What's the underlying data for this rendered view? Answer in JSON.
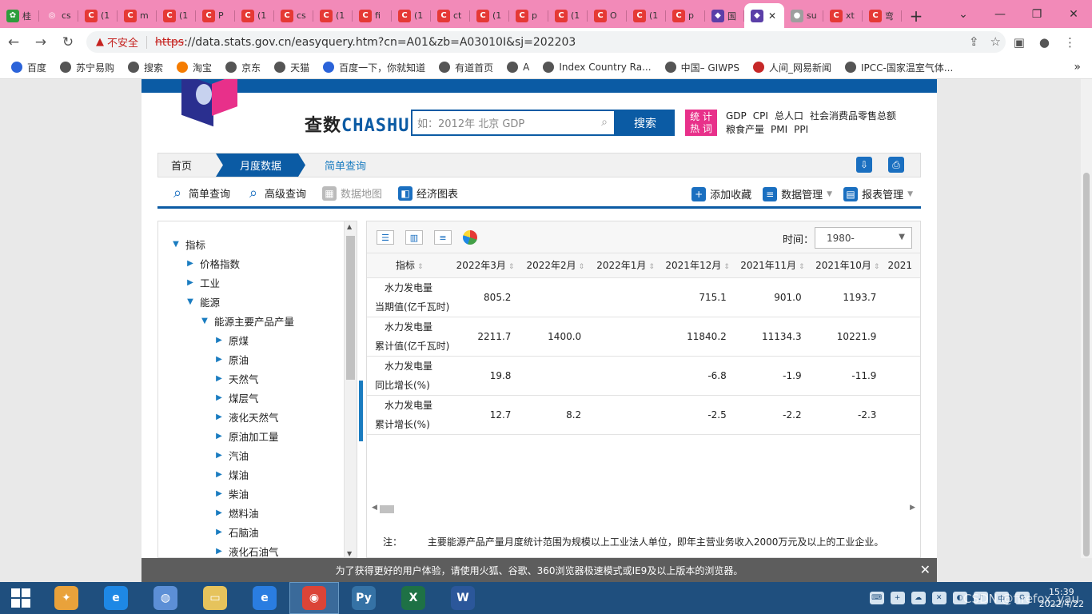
{
  "tabs": [
    {
      "label": "桂",
      "color": "#2e9d3c",
      "glyph": "✿"
    },
    {
      "label": "cs",
      "color": "#f28ab8",
      "glyph": "◎"
    },
    {
      "label": "(1",
      "color": "#e53935",
      "glyph": "C"
    },
    {
      "label": "m",
      "color": "#e53935",
      "glyph": "C"
    },
    {
      "label": "(1",
      "color": "#e53935",
      "glyph": "C"
    },
    {
      "label": "P",
      "color": "#e53935",
      "glyph": "C"
    },
    {
      "label": "(1",
      "color": "#e53935",
      "glyph": "C"
    },
    {
      "label": "cs",
      "color": "#e53935",
      "glyph": "C"
    },
    {
      "label": "(1",
      "color": "#e53935",
      "glyph": "C"
    },
    {
      "label": "fi",
      "color": "#e53935",
      "glyph": "C"
    },
    {
      "label": "(1",
      "color": "#e53935",
      "glyph": "C"
    },
    {
      "label": "ct",
      "color": "#e53935",
      "glyph": "C"
    },
    {
      "label": "(1",
      "color": "#e53935",
      "glyph": "C"
    },
    {
      "label": "p",
      "color": "#e53935",
      "glyph": "C"
    },
    {
      "label": "(1",
      "color": "#e53935",
      "glyph": "C"
    },
    {
      "label": "O",
      "color": "#e53935",
      "glyph": "C"
    },
    {
      "label": "(1",
      "color": "#e53935",
      "glyph": "C"
    },
    {
      "label": "p",
      "color": "#e53935",
      "glyph": "C"
    },
    {
      "label": "国",
      "color": "#5b3fa8",
      "glyph": "◆"
    }
  ],
  "active_tab": {
    "label": "",
    "close": "✕"
  },
  "tabs_after": [
    {
      "label": "su",
      "color": "#9e9e9e",
      "glyph": "●"
    },
    {
      "label": "xt",
      "color": "#e53935",
      "glyph": "C"
    },
    {
      "label": "弯",
      "color": "#e53935",
      "glyph": "C"
    }
  ],
  "new_tab_label": "+",
  "window_controls": [
    "⌄",
    "—",
    "❐",
    "✕"
  ],
  "nav": {
    "back": "←",
    "forward": "→",
    "reload": "↻"
  },
  "address": {
    "warning_icon": "▲",
    "insecure_label": "不安全",
    "url_scheme": "https",
    "url_rest": "://data.stats.gov.cn/easyquery.htm?cn=A01&zb=A03010I&sj=202203"
  },
  "omnibox_icons": [
    "⇪",
    "☆"
  ],
  "toolbar_icons": [
    "▣",
    "●",
    "⋮"
  ],
  "bookmarks": [
    {
      "label": "百度",
      "color": "#2b63d9"
    },
    {
      "label": "苏宁易购",
      "color": "#555"
    },
    {
      "label": "搜索",
      "color": "#555"
    },
    {
      "label": "淘宝",
      "color": "#f57c00"
    },
    {
      "label": "京东",
      "color": "#555"
    },
    {
      "label": "天猫",
      "color": "#555"
    },
    {
      "label": "百度一下，你就知道",
      "color": "#2b63d9"
    },
    {
      "label": "有道首页",
      "color": "#555"
    },
    {
      "label": "A",
      "color": "#555"
    },
    {
      "label": "Index Country Ra...",
      "color": "#555"
    },
    {
      "label": "中国– GIWPS",
      "color": "#555"
    },
    {
      "label": "人间_网易新闻",
      "color": "#c62828"
    },
    {
      "label": "IPCC-国家温室气体...",
      "color": "#555"
    }
  ],
  "bookmarks_more": "»",
  "site": {
    "logo_top": "查数",
    "logo_latin": "CHASHU",
    "search_placeholder": "如：2012年 北京 GDP",
    "search_button": "搜索",
    "hot_badge_line1": "统 计",
    "hot_badge_line2": "热 词",
    "hot_words_row1": [
      "GDP",
      "CPI",
      "总人口",
      "社会消费品零售总额"
    ],
    "hot_words_row2": [
      "粮食产量",
      "PMI",
      "PPI"
    ],
    "breadcrumb": {
      "home": "首页",
      "month": "月度数据",
      "simple": "简单查询"
    },
    "tools": [
      {
        "label": "简单查询",
        "icon": "⌕",
        "disabled": false
      },
      {
        "label": "高级查询",
        "icon": "⌕",
        "disabled": false
      },
      {
        "label": "数据地图",
        "icon": "▦",
        "disabled": true
      },
      {
        "label": "经济图表",
        "icon": "◧",
        "disabled": false
      }
    ],
    "tools_right": [
      {
        "label": "添加收藏",
        "icon": "+",
        "dropdown": false
      },
      {
        "label": "数据管理",
        "icon": "≡",
        "dropdown": true
      },
      {
        "label": "报表管理",
        "icon": "▤",
        "dropdown": true
      }
    ],
    "tree": [
      {
        "label": "指标",
        "level": 0,
        "expanded": true
      },
      {
        "label": "价格指数",
        "level": 1,
        "expanded": false
      },
      {
        "label": "工业",
        "level": 1,
        "expanded": false
      },
      {
        "label": "能源",
        "level": 1,
        "expanded": true
      },
      {
        "label": "能源主要产品产量",
        "level": 2,
        "expanded": true
      },
      {
        "label": "原煤",
        "level": 3,
        "expanded": false
      },
      {
        "label": "原油",
        "level": 3,
        "expanded": false
      },
      {
        "label": "天然气",
        "level": 3,
        "expanded": false
      },
      {
        "label": "煤层气",
        "level": 3,
        "expanded": false
      },
      {
        "label": "液化天然气",
        "level": 3,
        "expanded": false
      },
      {
        "label": "原油加工量",
        "level": 3,
        "expanded": false
      },
      {
        "label": "汽油",
        "level": 3,
        "expanded": false
      },
      {
        "label": "煤油",
        "level": 3,
        "expanded": false
      },
      {
        "label": "柴油",
        "level": 3,
        "expanded": false
      },
      {
        "label": "燃料油",
        "level": 3,
        "expanded": false
      },
      {
        "label": "石脑油",
        "level": 3,
        "expanded": false
      },
      {
        "label": "液化石油气",
        "level": 3,
        "expanded": false
      }
    ],
    "time_label": "时间：",
    "time_value": "1980-",
    "table": {
      "columns": [
        "指标",
        "2022年3月",
        "2022年2月",
        "2022年1月",
        "2021年12月",
        "2021年11月",
        "2021年10月",
        "2021"
      ],
      "rows": [
        {
          "name1": "水力发电量",
          "name2": "当期值(亿千瓦时)",
          "values": [
            "805.2",
            "",
            "",
            "715.1",
            "901.0",
            "1193.7",
            ""
          ]
        },
        {
          "name1": "水力发电量",
          "name2": "累计值(亿千瓦时)",
          "values": [
            "2211.7",
            "1400.0",
            "",
            "11840.2",
            "11134.3",
            "10221.9",
            ""
          ]
        },
        {
          "name1": "水力发电量",
          "name2": "同比增长(%)",
          "values": [
            "19.8",
            "",
            "",
            "-6.8",
            "-1.9",
            "-11.9",
            ""
          ]
        },
        {
          "name1": "水力发电量",
          "name2": "累计增长(%)",
          "values": [
            "12.7",
            "8.2",
            "",
            "-2.5",
            "-2.2",
            "-2.3",
            ""
          ]
        }
      ]
    },
    "note_label": "注：",
    "note_text": "主要能源产品产量月度统计范围为规模以上工业法人单位，即年主营业务收入2000万元及以上的工业企业。",
    "banner_text": "为了获得更好的用户体验，请使用火狐、谷歌、360浏览器极速模式或IE9及以上版本的浏览器。",
    "banner_close": "✕"
  },
  "taskbar": {
    "apps": [
      {
        "name": "app-colorful",
        "color": "#e9a23b",
        "glyph": "✦"
      },
      {
        "name": "app-ie-old",
        "color": "#1e88e5",
        "glyph": "e"
      },
      {
        "name": "app-globe",
        "color": "#5c8fd6",
        "glyph": "◍"
      },
      {
        "name": "app-folder",
        "color": "#e6c35c",
        "glyph": "▭"
      },
      {
        "name": "app-ie",
        "color": "#2a7de1",
        "glyph": "e"
      },
      {
        "name": "app-chrome",
        "color": "#db4437",
        "glyph": "◉"
      },
      {
        "name": "app-python",
        "color": "#3572a5",
        "glyph": "Py"
      },
      {
        "name": "app-excel",
        "color": "#1e7145",
        "glyph": "X"
      },
      {
        "name": "app-word",
        "color": "#2b579a",
        "glyph": "W"
      }
    ],
    "tray_icons": [
      "⌨",
      "+",
      "☁",
      "✕",
      "◐",
      "♪",
      "中",
      "⚙"
    ],
    "time": "15:39",
    "date": "2022/4/22",
    "watermark": "CSDN @firefox_yau"
  }
}
